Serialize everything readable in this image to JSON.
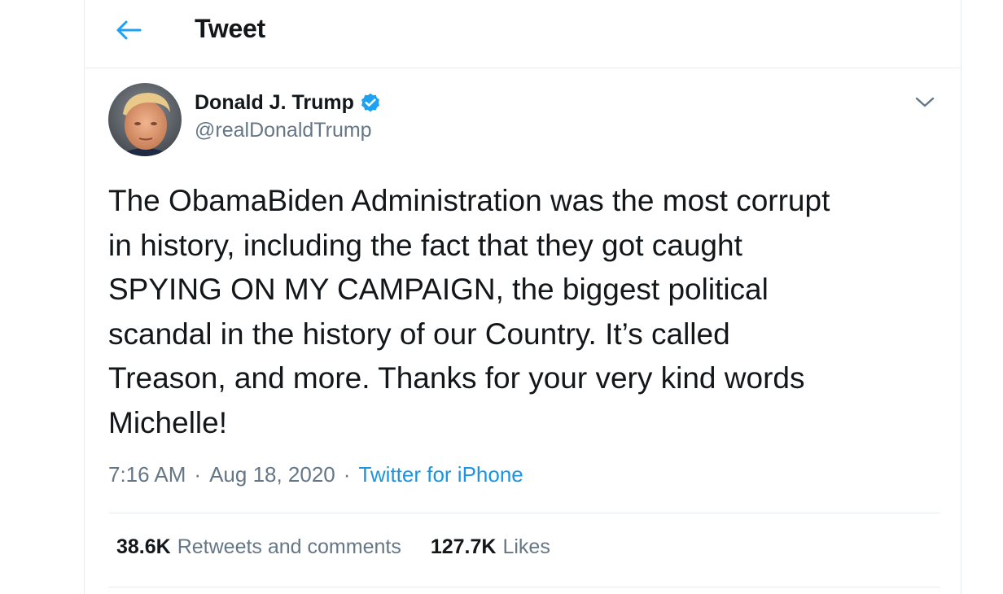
{
  "header": {
    "title": "Tweet",
    "back_icon": "arrow-left-icon"
  },
  "colors": {
    "accent": "#1da1f2",
    "link": "#1b95e0",
    "text_primary": "#14171a",
    "text_secondary": "#657786",
    "divider": "#e6ecf0"
  },
  "tweet": {
    "author": {
      "display_name": "Donald J. Trump",
      "handle": "@realDonaldTrump",
      "verified": true,
      "avatar_icon": "avatar"
    },
    "text": "The ObamaBiden Administration was the most corrupt\nin history, including the fact that they got caught\nSPYING ON MY CAMPAIGN, the biggest political\nscandal in the history of our Country. It’s called\nTreason, and more. Thanks for your very kind words\nMichelle!",
    "time": "7:16 AM",
    "separator": "·",
    "date": "Aug 18, 2020",
    "source": "Twitter for iPhone",
    "stats": {
      "retweets_count": "38.6K",
      "retweets_label": "Retweets and comments",
      "likes_count": "127.7K",
      "likes_label": "Likes"
    }
  }
}
